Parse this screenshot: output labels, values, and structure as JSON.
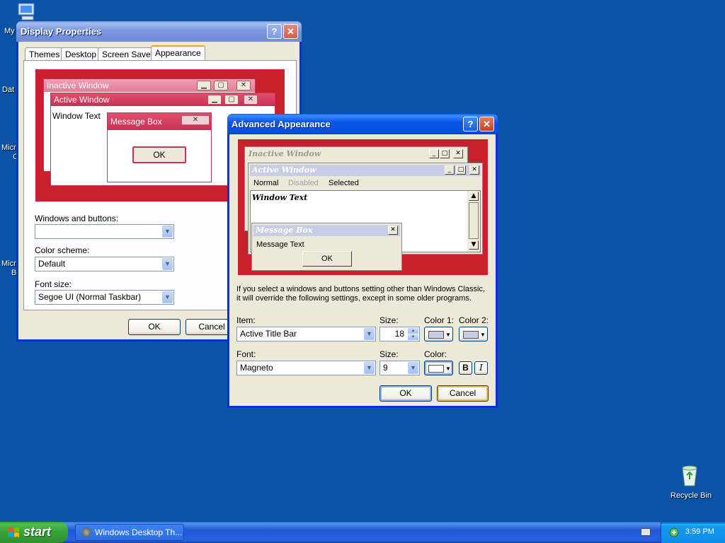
{
  "desktop": {
    "icons": [
      {
        "label": "My",
        "icon": "my-computer-icon"
      },
      {
        "label": "Dat",
        "icon": "folder-icon"
      },
      {
        "label": "Micr",
        "label2": "C",
        "icon": "app-icon"
      },
      {
        "label": "Micr",
        "label2": "B",
        "icon": "app-icon"
      }
    ],
    "recycle_bin": "Recycle Bin"
  },
  "display_properties": {
    "title": "Display Properties",
    "tabs": [
      "Themes",
      "Desktop",
      "Screen Saver",
      "Appearance"
    ],
    "active_tab": "Appearance",
    "preview": {
      "inactive_window": "Inactive Window",
      "active_window": "Active Window",
      "window_text": "Window Text",
      "message_box": "Message Box",
      "ok": "OK"
    },
    "windows_and_buttons_label": "Windows and buttons:",
    "windows_and_buttons_value": "",
    "color_scheme_label": "Color scheme:",
    "color_scheme_value": "Default",
    "font_size_label": "Font size:",
    "font_size_value": "Segoe UI (Normal Taskbar)",
    "ok": "OK",
    "cancel": "Cancel"
  },
  "advanced_appearance": {
    "title": "Advanced Appearance",
    "preview": {
      "inactive_window": "Inactive Window",
      "active_window": "Active Window",
      "normal": "Normal",
      "disabled": "Disabled",
      "selected": "Selected",
      "window_text": "Window Text",
      "message_box": "Message Box",
      "message_text": "Message Text",
      "ok": "OK"
    },
    "info_line1": "If you select a windows and buttons setting other than Windows Classic,",
    "info_line2": "it will override the following settings, except in some older programs.",
    "item_label": "Item:",
    "item_value": "Active Title Bar",
    "size_label": "Size:",
    "item_size_value": "18",
    "color1_label": "Color 1:",
    "color2_label": "Color 2:",
    "font_label": "Font:",
    "font_value": "Magneto",
    "font_size_label": "Size:",
    "font_size_value": "9",
    "color_label": "Color:",
    "bold": "B",
    "italic": "I",
    "ok": "OK",
    "cancel": "Cancel"
  },
  "taskbar": {
    "start": "start",
    "task": "Windows Desktop Th...",
    "clock": "3:59 PM"
  },
  "colors": {
    "desktop": "#0a53a6",
    "titlebar": "#0856e5",
    "preview_bg": "#c8202c"
  }
}
